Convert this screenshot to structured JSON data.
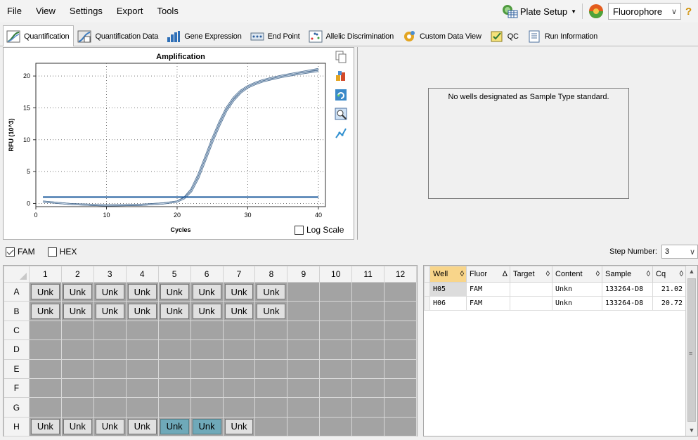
{
  "menu": {
    "items": [
      "File",
      "View",
      "Settings",
      "Export",
      "Tools"
    ]
  },
  "toolbar": {
    "plate_setup": "Plate Setup",
    "fluorophore": "Fluorophore",
    "help": "?"
  },
  "tabs": [
    {
      "label": "Quantification",
      "icon": "amplification-tab-icon",
      "active": true
    },
    {
      "label": "Quantification Data",
      "icon": "quant-data-tab-icon"
    },
    {
      "label": "Gene Expression",
      "icon": "bar-chart-tab-icon"
    },
    {
      "label": "End Point",
      "icon": "endpoint-tab-icon"
    },
    {
      "label": "Allelic Discrimination",
      "icon": "allelic-tab-icon"
    },
    {
      "label": "Custom Data View",
      "icon": "gear-tab-icon"
    },
    {
      "label": "QC",
      "icon": "qc-tab-icon"
    },
    {
      "label": "Run Information",
      "icon": "run-info-tab-icon"
    }
  ],
  "chart_data": {
    "type": "line",
    "title": "Amplification",
    "xlabel": "Cycles",
    "ylabel": "RFU (10^3)",
    "xlim": [
      0,
      41
    ],
    "ylim": [
      -0.5,
      22
    ],
    "xticks": [
      0,
      10,
      20,
      30,
      40
    ],
    "yticks": [
      0,
      5,
      10,
      15,
      20
    ],
    "grid": true,
    "threshold": 1.0,
    "series": [
      {
        "x": [
          1,
          5,
          10,
          15,
          18,
          20,
          21,
          22,
          23,
          24,
          25,
          26,
          27,
          28,
          29,
          30,
          31,
          32,
          33,
          35,
          37,
          40
        ],
        "values": [
          0.3,
          -0.1,
          -0.3,
          -0.2,
          0.0,
          0.3,
          0.9,
          2.2,
          4.5,
          7.3,
          10.2,
          12.8,
          15.0,
          16.6,
          17.7,
          18.4,
          18.9,
          19.3,
          19.6,
          20.1,
          20.5,
          21.1
        ]
      },
      {
        "x": [
          1,
          5,
          10,
          15,
          18,
          20,
          21,
          22,
          23,
          24,
          25,
          26,
          27,
          28,
          29,
          30,
          31,
          32,
          33,
          35,
          37,
          40
        ],
        "values": [
          0.3,
          -0.1,
          -0.3,
          -0.2,
          0.0,
          0.3,
          0.8,
          1.9,
          4.0,
          6.8,
          9.7,
          12.3,
          14.6,
          16.2,
          17.4,
          18.2,
          18.7,
          19.1,
          19.4,
          19.9,
          20.3,
          20.8
        ]
      }
    ],
    "colors": {
      "curve": "#8aa6c0",
      "threshold": "#1f5c9e"
    }
  },
  "chart": {
    "log_scale_label": "Log Scale"
  },
  "std_panel": {
    "message": "No wells designated as Sample Type standard."
  },
  "fluor_filters": [
    {
      "label": "FAM",
      "checked": true
    },
    {
      "label": "HEX",
      "checked": false
    }
  ],
  "step": {
    "label": "Step Number:",
    "value": "3"
  },
  "plate": {
    "columns": [
      "1",
      "2",
      "3",
      "4",
      "5",
      "6",
      "7",
      "8",
      "9",
      "10",
      "11",
      "12"
    ],
    "rows": [
      {
        "label": "A",
        "wells": [
          "Unk",
          "Unk",
          "Unk",
          "Unk",
          "Unk",
          "Unk",
          "Unk",
          "Unk",
          "",
          "",
          "",
          ""
        ]
      },
      {
        "label": "B",
        "wells": [
          "Unk",
          "Unk",
          "Unk",
          "Unk",
          "Unk",
          "Unk",
          "Unk",
          "Unk",
          "",
          "",
          "",
          ""
        ]
      },
      {
        "label": "C",
        "wells": [
          "",
          "",
          "",
          "",
          "",
          "",
          "",
          "",
          "",
          "",
          "",
          ""
        ]
      },
      {
        "label": "D",
        "wells": [
          "",
          "",
          "",
          "",
          "",
          "",
          "",
          "",
          "",
          "",
          "",
          ""
        ]
      },
      {
        "label": "E",
        "wells": [
          "",
          "",
          "",
          "",
          "",
          "",
          "",
          "",
          "",
          "",
          "",
          ""
        ]
      },
      {
        "label": "F",
        "wells": [
          "",
          "",
          "",
          "",
          "",
          "",
          "",
          "",
          "",
          "",
          "",
          ""
        ]
      },
      {
        "label": "G",
        "wells": [
          "",
          "",
          "",
          "",
          "",
          "",
          "",
          "",
          "",
          "",
          "",
          ""
        ]
      },
      {
        "label": "H",
        "wells": [
          "Unk",
          "Unk",
          "Unk",
          "Unk",
          "Unk",
          "Unk",
          "Unk",
          "",
          "",
          "",
          "",
          ""
        ]
      }
    ],
    "selected": [
      "H5",
      "H6"
    ]
  },
  "results": {
    "headers": [
      "Well",
      "Fluor",
      "Target",
      "Content",
      "Sample",
      "Cq"
    ],
    "rows": [
      [
        "H05",
        "FAM",
        "",
        "Unkn",
        "133264-D8",
        "21.02"
      ],
      [
        "H06",
        "FAM",
        "",
        "Unkn",
        "133264-D8",
        "20.72"
      ]
    ]
  }
}
